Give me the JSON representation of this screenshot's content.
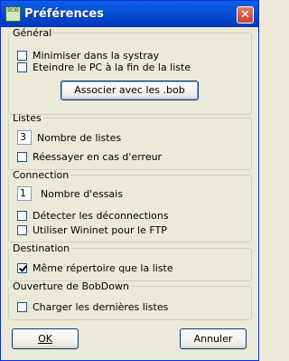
{
  "window": {
    "title": "Préférences",
    "icon_text": "BOB",
    "close": "✕"
  },
  "general": {
    "legend": "Général",
    "minimize_tray": {
      "label": "Minimiser dans la systray",
      "checked": false
    },
    "shutdown_pc": {
      "label": "Eteindre le PC à la fin de la liste",
      "checked": false
    },
    "associate_button": "Associer avec les .bob"
  },
  "listes": {
    "legend": "Listes",
    "count_value": "3",
    "count_label": "Nombre de listes",
    "retry_error": {
      "label": "Réessayer en cas d'erreur",
      "checked": false
    }
  },
  "connection": {
    "legend": "Connection",
    "tries_value": "1",
    "tries_label": "Nombre d'essais",
    "detect_disconnect": {
      "label": "Détecter les déconnections",
      "checked": false
    },
    "use_wininet": {
      "label": "Utiliser Wininet pour le FTP",
      "checked": false
    }
  },
  "destination": {
    "legend": "Destination",
    "same_dir": {
      "label": "Même répertoire que la liste",
      "checked": true
    }
  },
  "ouverture": {
    "legend": "Ouverture de BobDown",
    "load_last": {
      "label": "Charger les dernières listes",
      "checked": false
    }
  },
  "footer": {
    "ok": "OK",
    "cancel": "Annuler"
  }
}
